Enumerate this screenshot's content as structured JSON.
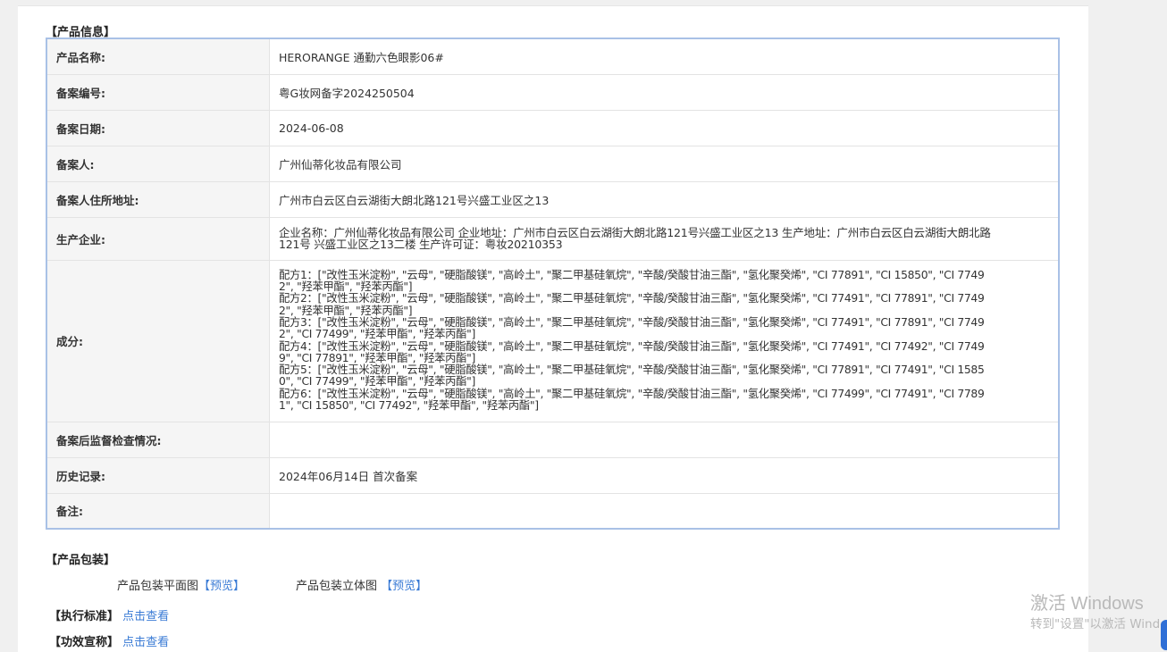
{
  "product_info": {
    "section_title": "【产品信息】",
    "rows": [
      {
        "label": "产品名称:",
        "value": "HERORANGE 通勤六色眼影06#"
      },
      {
        "label": "备案编号:",
        "value": "粤G妆网备字2024250504"
      },
      {
        "label": "备案日期:",
        "value": "2024-06-08"
      },
      {
        "label": "备案人:",
        "value": "广州仙蒂化妆品有限公司"
      },
      {
        "label": "备案人住所地址:",
        "value": "广州市白云区白云湖街大朗北路121号兴盛工业区之13"
      },
      {
        "label": "生产企业:",
        "value": "企业名称：广州仙蒂化妆品有限公司 企业地址：广州市白云区白云湖街大朗北路121号兴盛工业区之13 生产地址：广州市白云区白云湖街大朗北路121号 兴盛工业区之13二楼 生产许可证：粤妆20210353"
      },
      {
        "label": "成分:",
        "lines": [
          "配方1：[\"改性玉米淀粉\", \"云母\", \"硬脂酸镁\", \"高岭土\", \"聚二甲基硅氧烷\", \"辛酸/癸酸甘油三酯\", \"氢化聚癸烯\", \"CI 77891\", \"CI 15850\", \"CI 77492\", \"羟苯甲酯\", \"羟苯丙酯\"]",
          "配方2：[\"改性玉米淀粉\", \"云母\", \"硬脂酸镁\", \"高岭土\", \"聚二甲基硅氧烷\", \"辛酸/癸酸甘油三酯\", \"氢化聚癸烯\", \"CI 77491\", \"CI 77891\", \"CI 77492\", \"羟苯甲酯\", \"羟苯丙酯\"]",
          "配方3：[\"改性玉米淀粉\", \"云母\", \"硬脂酸镁\", \"高岭土\", \"聚二甲基硅氧烷\", \"辛酸/癸酸甘油三酯\", \"氢化聚癸烯\", \"CI 77491\", \"CI 77891\", \"CI 77492\", \"CI 77499\", \"羟苯甲酯\", \"羟苯丙酯\"]",
          "配方4：[\"改性玉米淀粉\", \"云母\", \"硬脂酸镁\", \"高岭土\", \"聚二甲基硅氧烷\", \"辛酸/癸酸甘油三酯\", \"氢化聚癸烯\", \"CI 77491\", \"CI 77492\", \"CI 77499\", \"CI 77891\", \"羟苯甲酯\", \"羟苯丙酯\"]",
          "配方5：[\"改性玉米淀粉\", \"云母\", \"硬脂酸镁\", \"高岭土\", \"聚二甲基硅氧烷\", \"辛酸/癸酸甘油三酯\", \"氢化聚癸烯\", \"CI 77891\", \"CI 77491\", \"CI 15850\", \"CI 77499\", \"羟苯甲酯\", \"羟苯丙酯\"]",
          "配方6：[\"改性玉米淀粉\", \"云母\", \"硬脂酸镁\", \"高岭土\", \"聚二甲基硅氧烷\", \"辛酸/癸酸甘油三酯\", \"氢化聚癸烯\", \"CI 77499\", \"CI 77491\", \"CI 77891\", \"CI 15850\", \"CI 77492\", \"羟苯甲酯\", \"羟苯丙酯\"]"
        ]
      },
      {
        "label": "备案后监督检查情况:",
        "value": ""
      },
      {
        "label": "历史记录:",
        "value": "2024年06月14日 首次备案"
      },
      {
        "label": "备注:",
        "value": ""
      }
    ]
  },
  "packaging": {
    "section_title": "【产品包装】",
    "flat_label": "产品包装平面图",
    "flat_link": "【预览】",
    "stereo_label": "产品包装立体图",
    "stereo_link": "【预览】"
  },
  "standard": {
    "label": "【执行标准】",
    "link": "点击查看"
  },
  "efficacy": {
    "label": "【功效宣称】",
    "link": "点击查看"
  },
  "watermark": {
    "line1": "激活 Windows",
    "line2": "转到\"设置\"以激活 Windows。"
  },
  "colors": {
    "accent_link": "#3a7bd5",
    "table_border": "#a9c1e6",
    "label_bg": "#f5f5f5"
  }
}
